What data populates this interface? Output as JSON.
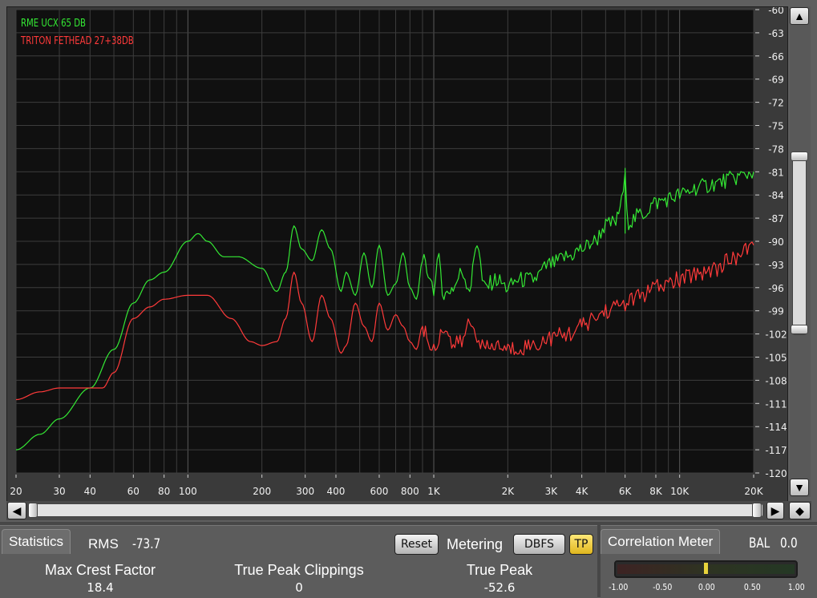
{
  "legend": [
    {
      "label": "RME UCX 65 DB",
      "color": "#34e834"
    },
    {
      "label": "TRITON FETHEAD 27+38DB",
      "color": "#ff3a3a"
    }
  ],
  "y_axis_labels": [
    "-60",
    "-63",
    "-66",
    "-69",
    "-72",
    "-75",
    "-78",
    "-81",
    "-84",
    "-87",
    "-90",
    "-93",
    "-96",
    "-99",
    "-102",
    "-105",
    "-108",
    "-111",
    "-114",
    "-117",
    "-120"
  ],
  "x_axis_labels": [
    "20",
    "30",
    "40",
    "60",
    "80",
    "100",
    "200",
    "300",
    "400",
    "600",
    "800",
    "1K",
    "2K",
    "3K",
    "4K",
    "6K",
    "8K",
    "10K",
    "20K"
  ],
  "statistics": {
    "tab_label": "Statistics",
    "rms_label": "RMS",
    "rms_value": "-73.7",
    "reset_label": "Reset",
    "metering_label": "Metering",
    "dbfs_label": "DBFS",
    "tp_label": "TP",
    "max_crest_factor_label": "Max Crest Factor",
    "max_crest_factor_value": "18.4",
    "true_peak_clippings_label": "True Peak Clippings",
    "true_peak_clippings_value": "0",
    "true_peak_label": "True Peak",
    "true_peak_value": "-52.6"
  },
  "correlation": {
    "tab_label": "Correlation Meter",
    "bal_label": "BAL",
    "bal_value": "0.0",
    "scale": [
      "-1.00",
      "-0.50",
      "0.00",
      "0.50",
      "1.00"
    ],
    "value": 0.0
  },
  "icons": {
    "up": "▲",
    "down": "▼",
    "left": "◀",
    "right": "▶",
    "diamond": "◆"
  },
  "chart_data": {
    "type": "line",
    "x_scale": "log",
    "xlim": [
      20,
      20000
    ],
    "ylim": [
      -120,
      -60
    ],
    "grid": true,
    "legend_position": "top-left",
    "series": [
      {
        "name": "RME UCX 65 DB",
        "color": "#34e834",
        "x": [
          20,
          25,
          30,
          40,
          50,
          60,
          70,
          80,
          100,
          110,
          120,
          140,
          160,
          200,
          230,
          250,
          270,
          290,
          320,
          350,
          380,
          420,
          440,
          480,
          520,
          560,
          600,
          650,
          700,
          750,
          800,
          850,
          900,
          950,
          1000,
          1050,
          1100,
          1200,
          1300,
          1400,
          1500,
          1600,
          1800,
          2000,
          2200,
          2500,
          3000,
          3500,
          4000,
          4500,
          5000,
          5500,
          5800,
          6000,
          6200,
          7000,
          8000,
          9000,
          10000,
          12000,
          14000,
          16000,
          18000,
          20000
        ],
        "y": [
          -117,
          -115,
          -113,
          -109,
          -104,
          -98,
          -95,
          -94,
          -90,
          -89,
          -90,
          -92,
          -92,
          -93.5,
          -96.5,
          -94,
          -88,
          -91,
          -92.5,
          -88.5,
          -91,
          -96.5,
          -94,
          -97,
          -91.5,
          -96,
          -90.5,
          -97,
          -95.5,
          -91.5,
          -96,
          -97.5,
          -92.5,
          -94,
          -96,
          -92.5,
          -97,
          -96,
          -94,
          -96,
          -90,
          -96,
          -95,
          -96,
          -95,
          -95,
          -93,
          -92,
          -91,
          -90,
          -88,
          -87.5,
          -85,
          -82,
          -87.5,
          -86.5,
          -85,
          -84.5,
          -84,
          -83,
          -82.5,
          -82,
          -81.5,
          -81
        ]
      },
      {
        "name": "TRITON FETHEAD 27+38DB",
        "color": "#ff3a3a",
        "x": [
          20,
          25,
          30,
          35,
          40,
          45,
          50,
          60,
          70,
          80,
          100,
          110,
          120,
          150,
          180,
          200,
          230,
          250,
          270,
          290,
          320,
          350,
          380,
          420,
          440,
          480,
          520,
          560,
          600,
          650,
          700,
          750,
          800,
          850,
          900,
          950,
          1000,
          1100,
          1200,
          1300,
          1400,
          1500,
          1600,
          1800,
          2000,
          2500,
          3000,
          3500,
          4000,
          4500,
          5000,
          6000,
          7000,
          8000,
          10000,
          12000,
          14000,
          16000,
          18000,
          20000
        ],
        "y": [
          -110.5,
          -109.5,
          -109,
          -109,
          -109,
          -109,
          -107,
          -100,
          -98.5,
          -97.5,
          -97,
          -97,
          -97,
          -100,
          -103,
          -103.5,
          -103,
          -100,
          -94,
          -98,
          -103,
          -97,
          -100,
          -104.5,
          -103.5,
          -98,
          -101,
          -103,
          -98,
          -101.5,
          -99.5,
          -101,
          -103,
          -104,
          -101,
          -103,
          -104,
          -101,
          -103.5,
          -103,
          -100.5,
          -102,
          -104,
          -103.5,
          -104,
          -103.5,
          -102.5,
          -102,
          -101,
          -100,
          -99,
          -98,
          -97,
          -96,
          -95,
          -94,
          -93.5,
          -92.5,
          -91.5,
          -90.5
        ]
      }
    ]
  }
}
